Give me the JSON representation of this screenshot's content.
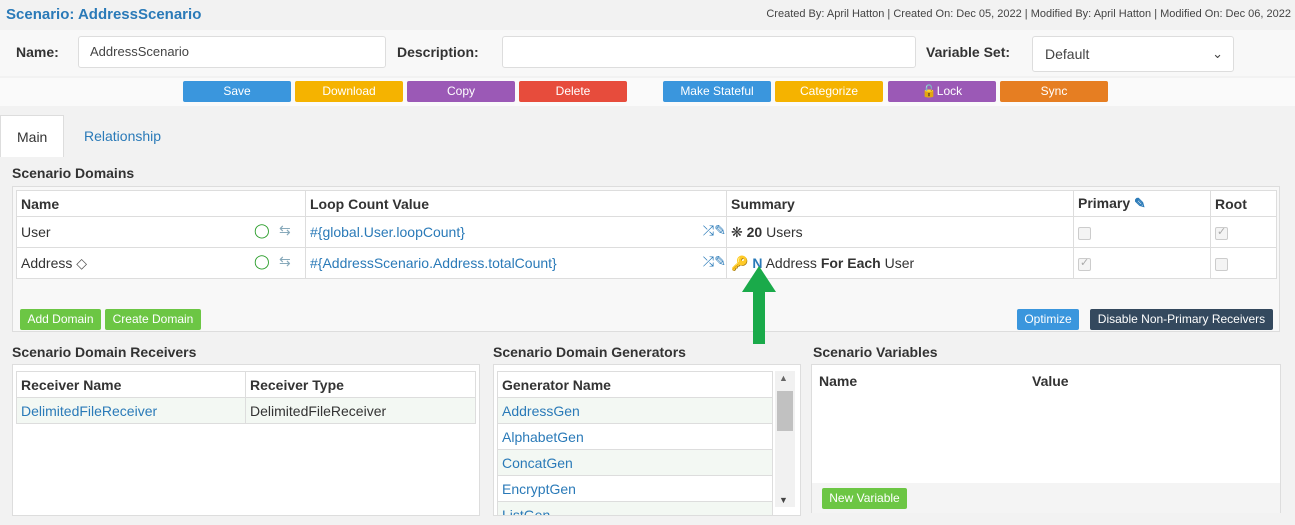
{
  "header": {
    "title": "Scenario: AddressScenario",
    "meta": "Created By: April Hatton | Created On: Dec 05, 2022 | Modified By: April Hatton | Modified On: Dec 06, 2022"
  },
  "form": {
    "name_label": "Name:",
    "name_value": "AddressScenario",
    "description_label": "Description:",
    "description_value": "",
    "variable_set_label": "Variable Set:",
    "variable_set_value": "Default"
  },
  "toolbar": {
    "save": "Save",
    "download": "Download",
    "copy": "Copy",
    "delete": "Delete",
    "make_stateful": "Make Stateful",
    "categorize": "Categorize",
    "lock": "Lock",
    "sync": "Sync"
  },
  "tabs": {
    "main": "Main",
    "relationship": "Relationship"
  },
  "domains": {
    "section_title": "Scenario Domains",
    "columns": [
      "Name",
      "Loop Count Value",
      "Summary",
      "Primary",
      "Root"
    ],
    "rows": [
      {
        "name": "User",
        "loop": "#{global.User.loopCount}",
        "summary_count": "20",
        "summary_text": " Users",
        "primary_checked": false,
        "root_checked": true
      },
      {
        "name": "Address",
        "loop": "#{AddressScenario.Address.totalCount}",
        "summary_n": "N",
        "summary_mid": " Address ",
        "summary_bold": "For Each",
        "summary_end": " User",
        "primary_checked": true,
        "root_checked": false
      }
    ],
    "add_domain": "Add Domain",
    "create_domain": "Create Domain",
    "optimize": "Optimize",
    "disable_receivers": "Disable Non-Primary Receivers"
  },
  "receivers": {
    "section_title": "Scenario Domain Receivers",
    "columns": [
      "Receiver Name",
      "Receiver Type"
    ],
    "rows": [
      {
        "name": "DelimitedFileReceiver",
        "type": "DelimitedFileReceiver"
      }
    ]
  },
  "generators": {
    "section_title": "Scenario Domain Generators",
    "column": "Generator Name",
    "rows": [
      "AddressGen",
      "AlphabetGen",
      "ConcatGen",
      "EncryptGen",
      "ListGen"
    ]
  },
  "variables": {
    "section_title": "Scenario Variables",
    "col_name": "Name",
    "col_value": "Value",
    "new_variable": "New Variable"
  },
  "colors": {
    "link": "#2a7ab8",
    "save": "#3a96dd",
    "download": "#f5b300",
    "copy": "#9b59b6",
    "delete": "#e74c3c",
    "make_stateful": "#3a96dd",
    "categorize": "#f5b300",
    "lock": "#9b59b6",
    "sync": "#e67e22",
    "add": "#6cc644",
    "dark": "#34495e",
    "arrow": "#1aaa4a"
  }
}
